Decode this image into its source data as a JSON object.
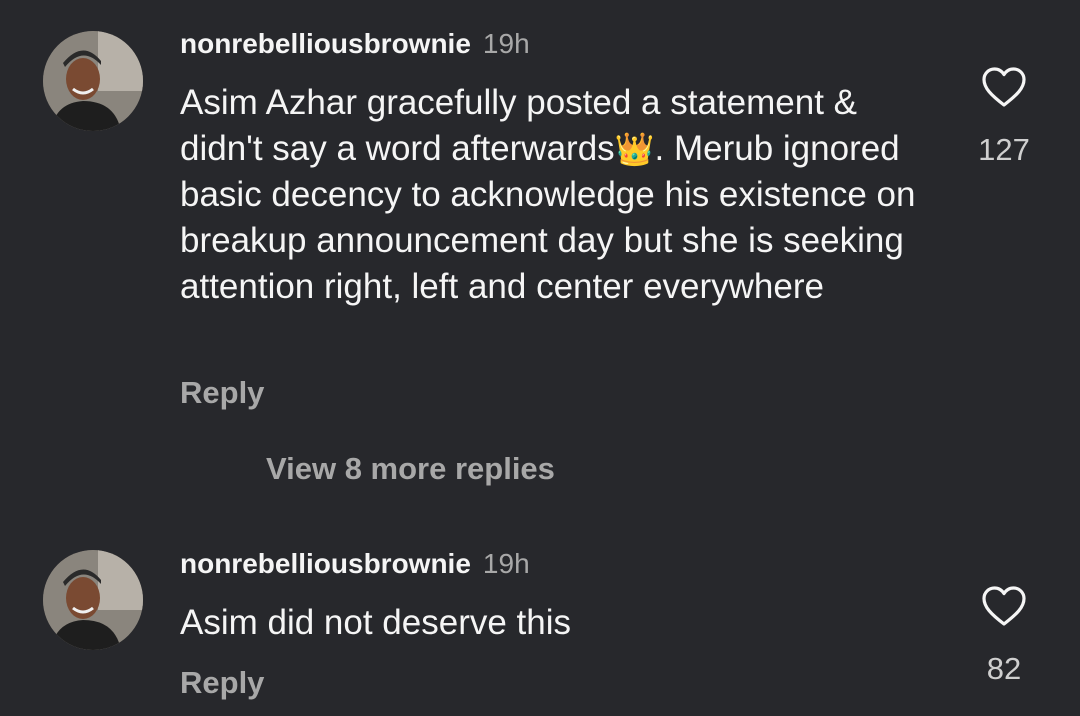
{
  "comments": [
    {
      "username": "nonrebelliousbrownie",
      "time": "19h",
      "text_before": "Asim Azhar gracefully posted a statement & didn't say a word afterwards",
      "emoji": "👑",
      "text_after": ". Merub ignored basic decency to acknowledge his existence on breakup announcement day but she is seeking attention right, left and center everywhere",
      "likes": "127",
      "reply_label": "Reply",
      "like_icon": "heart-outline-icon"
    },
    {
      "username": "nonrebelliousbrownie",
      "time": "19h",
      "text": "Asim did not deserve this",
      "likes": "82",
      "reply_label": "Reply",
      "like_icon": "heart-outline-icon"
    }
  ],
  "view_more_replies": "View 8 more replies",
  "colors": {
    "background": "#27282c",
    "primary_text": "#f5f5f5",
    "secondary_text": "#a8a8a8"
  }
}
